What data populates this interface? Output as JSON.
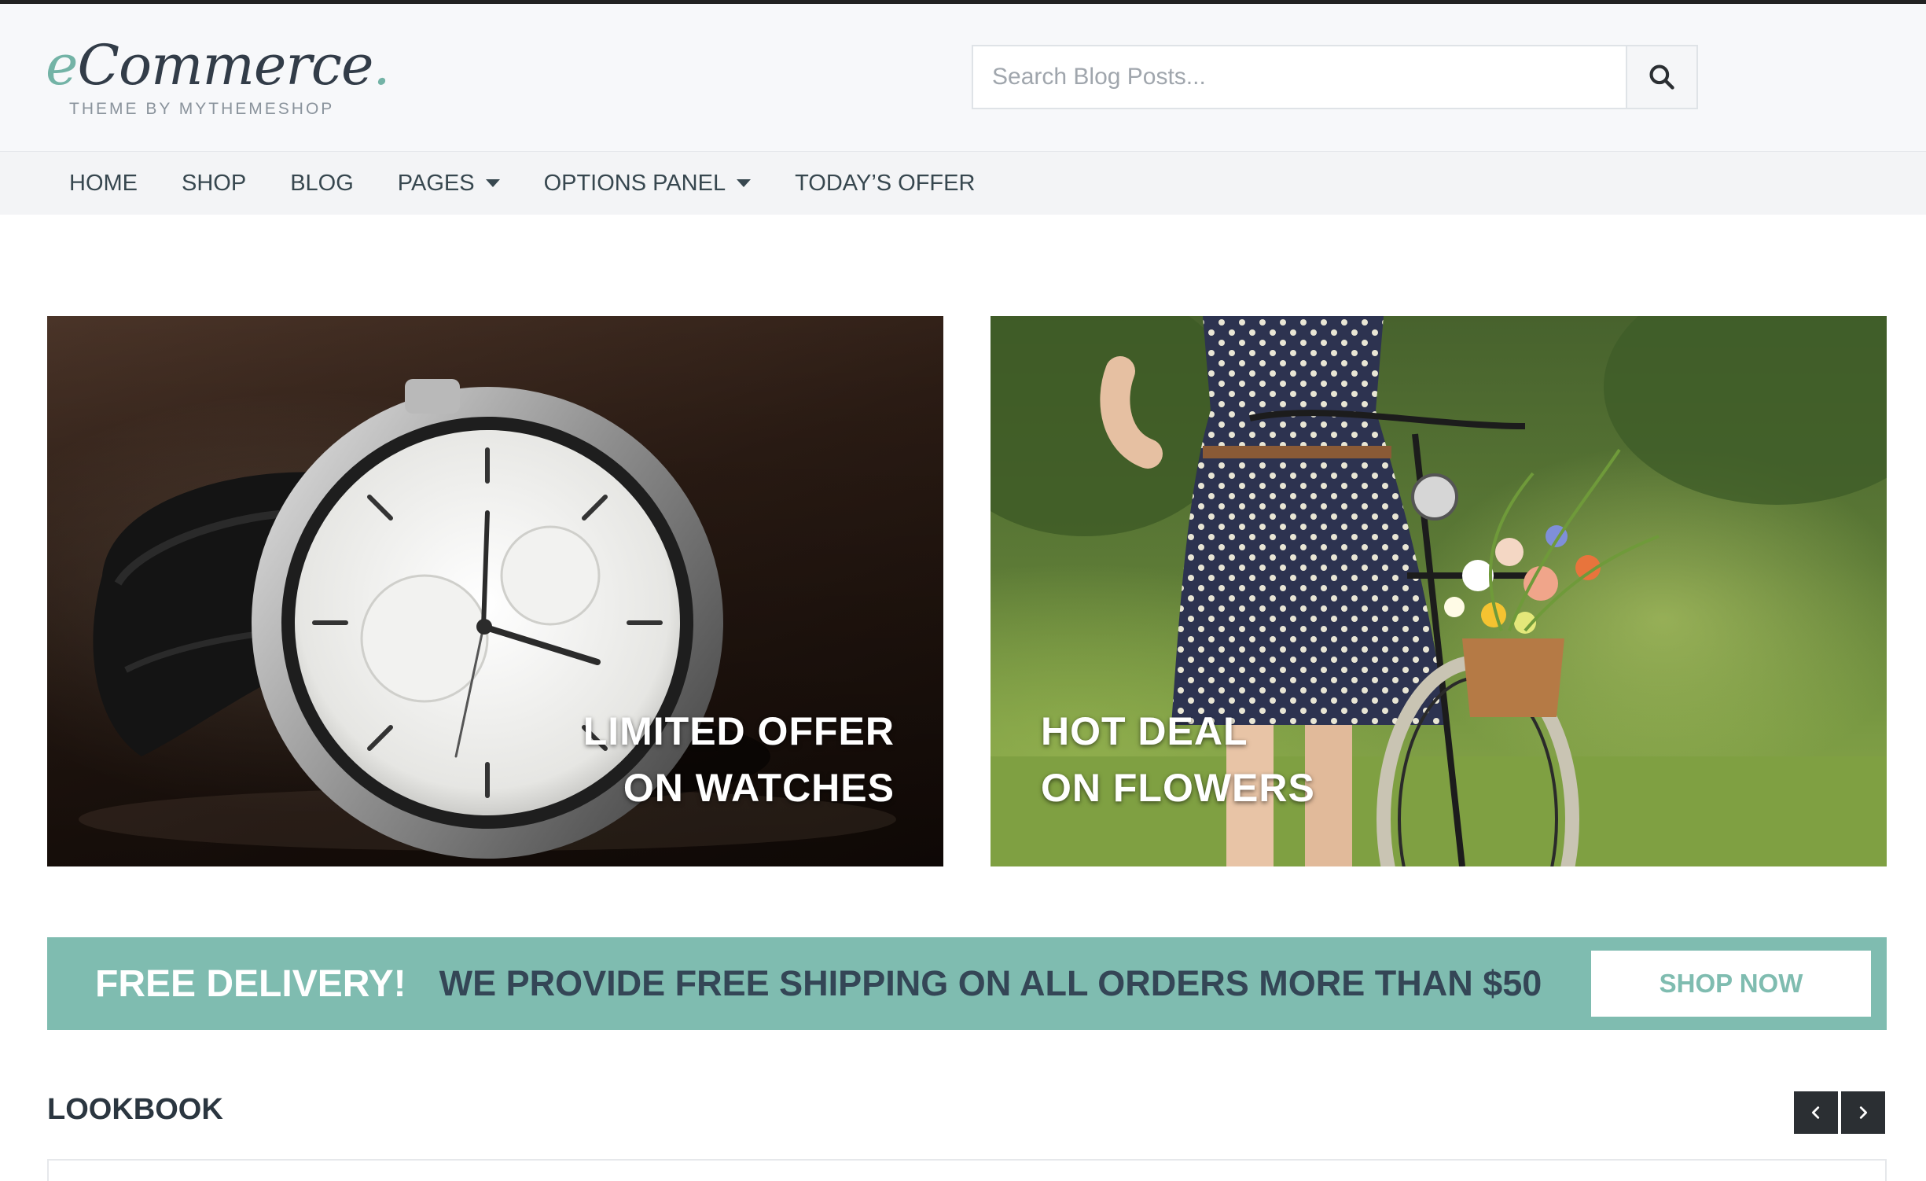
{
  "header": {
    "logo_script": "Commerce",
    "logo_initial": "e",
    "logo_dot": ".",
    "logo_tagline": "THEME BY MYTHEMESHOP",
    "search_placeholder": "Search Blog Posts..."
  },
  "nav": {
    "items": [
      {
        "label": "HOME",
        "has_dropdown": false
      },
      {
        "label": "SHOP",
        "has_dropdown": false
      },
      {
        "label": "BLOG",
        "has_dropdown": false
      },
      {
        "label": "PAGES",
        "has_dropdown": true
      },
      {
        "label": "OPTIONS PANEL",
        "has_dropdown": true
      },
      {
        "label": "TODAY’S OFFER",
        "has_dropdown": false
      }
    ]
  },
  "banners": {
    "watches": {
      "line1": "LIMITED OFFER",
      "line2": "ON WATCHES"
    },
    "flowers": {
      "line1": "HOT DEAL",
      "line2": "ON FLOWERS"
    }
  },
  "delivery": {
    "headline": "FREE DELIVERY!",
    "text": "WE PROVIDE FREE SHIPPING ON ALL ORDERS MORE THAN $50",
    "button": "SHOP NOW"
  },
  "lookbook": {
    "title": "LOOKBOOK"
  },
  "colors": {
    "accent": "#7fbcb0",
    "dark_text": "#344656",
    "nav_bg": "#f3f4f6",
    "arrow_bg": "#2b2f33"
  },
  "icons": {
    "search": "search-icon",
    "prev": "chevron-left-icon",
    "next": "chevron-right-icon",
    "dropdown": "caret-down-icon"
  }
}
